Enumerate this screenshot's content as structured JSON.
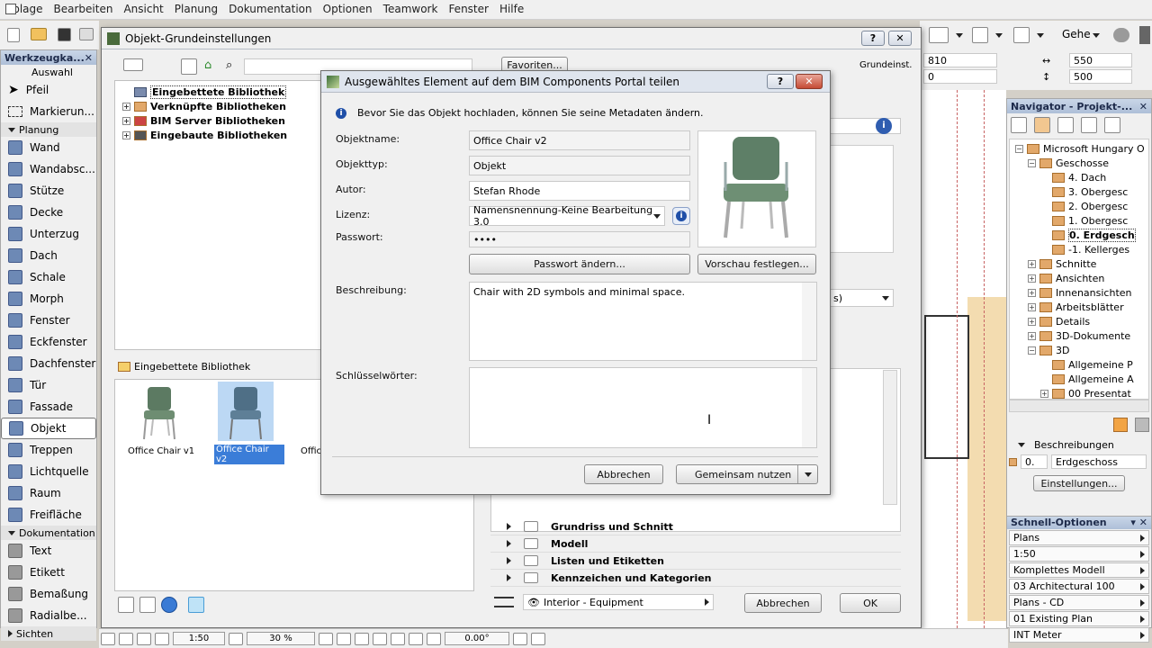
{
  "menu": [
    "Ablage",
    "Bearbeiten",
    "Ansicht",
    "Planung",
    "Dokumentation",
    "Optionen",
    "Teamwork",
    "Fenster",
    "Hilfe"
  ],
  "right_toolbar": {
    "view_label": "Gehe"
  },
  "coords": {
    "a": "810",
    "b": "0",
    "c": "550",
    "d": "500"
  },
  "toolbox": {
    "title": "Werkzeugka...",
    "select_label": "Auswahl",
    "arrow": "Pfeil",
    "marquee": "Markierun...",
    "group_planung": "Planung",
    "tools": [
      "Wand",
      "Wandabsc...",
      "Stütze",
      "Decke",
      "Unterzug",
      "Dach",
      "Schale",
      "Morph",
      "Fenster",
      "Eckfenster",
      "Dachfenster",
      "Tür",
      "Fassade",
      "Objekt",
      "Treppen",
      "Lichtquelle",
      "Raum",
      "Freifläche"
    ],
    "group_doku": "Dokumentation",
    "doku_tools": [
      "Text",
      "Etikett",
      "Bemaßung",
      "Radialbe..."
    ],
    "group_sichten": "Sichten"
  },
  "obj_dialog": {
    "title": "Objekt-Grundeinstellungen",
    "favorites": "Favoriten...",
    "grundeinst": "Grundeinst.",
    "tree": [
      "Eingebettete Bibliothek",
      "Verknüpfte Bibliotheken",
      "BIM Server Bibliotheken",
      "Eingebaute Bibliotheken"
    ],
    "folder_label": "Eingebettete Bibliothek",
    "thumbs": [
      "Office Chair v1",
      "Office Chair v2",
      "Offic"
    ],
    "sections": [
      "Grundriss und Schnitt",
      "Modell",
      "Listen und Etiketten",
      "Kennzeichen und Kategorien"
    ],
    "layer": "Interior - Equipment",
    "cancel": "Abbrechen",
    "ok": "OK",
    "dropdown_suffix": "s)"
  },
  "share_dialog": {
    "title": "Ausgewähltes Element auf dem BIM Components Portal teilen",
    "info": "Bevor Sie das Objekt hochladen, können Sie seine Metadaten ändern.",
    "labels": {
      "name": "Objektname:",
      "type": "Objekttyp:",
      "author": "Autor:",
      "license": "Lizenz:",
      "password": "Passwort:",
      "description": "Beschreibung:",
      "keywords": "Schlüsselwörter:"
    },
    "values": {
      "name": "Office Chair v2",
      "type": "Objekt",
      "author": "Stefan Rhode",
      "license": "Namensnennung-Keine Bearbeitung 3.0",
      "password": "••••",
      "description": "Chair with 2D symbols and minimal space.",
      "keywords": ""
    },
    "change_password": "Passwort ändern...",
    "set_preview": "Vorschau festlegen...",
    "cancel": "Abbrechen",
    "share": "Gemeinsam nutzen",
    "help": "?"
  },
  "navigator": {
    "title": "Navigator - Projekt-...",
    "items": [
      "Microsoft Hungary O",
      "Geschosse",
      "4. Dach",
      "3. Obergesc",
      "2. Obergesc",
      "1. Obergesc",
      "0. Erdgesch",
      "-1. Kellerges",
      "Schnitte",
      "Ansichten",
      "Innenansichten",
      "Arbeitsblätter",
      "Details",
      "3D-Dokumente",
      "3D",
      "Allgemeine P",
      "Allgemeine A",
      "00 Presentat"
    ],
    "desc_label": "Beschreibungen",
    "story_num": "0.",
    "story_name": "Erdgeschoss",
    "settings": "Einstellungen..."
  },
  "quick": {
    "title": "Schnell-Optionen",
    "items": [
      "Plans",
      "1:50",
      "Komplettes Modell",
      "03 Architectural 100",
      "Plans - CD",
      "01 Existing Plan",
      "INT Meter"
    ]
  },
  "status": {
    "scale": "1:50",
    "zoom": "30 %",
    "angle": "0.00°"
  }
}
